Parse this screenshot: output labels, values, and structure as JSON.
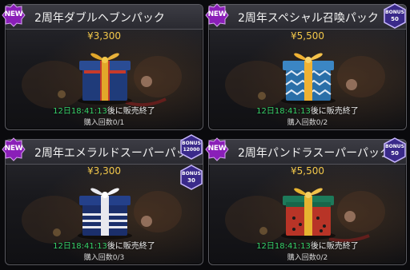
{
  "new_badge_label": "NEW",
  "bonus_label": "BONUS",
  "countdown_suffix": "後に販売終了",
  "cards": [
    {
      "title": "2周年ダブルヘブンパック",
      "price": "¥3,300",
      "countdown_time": "12日18:41:13",
      "purchases": "購入回数0/1",
      "box_color": "#1f3b7a",
      "ribbon_color": "#e2a72a"
    },
    {
      "title": "2周年スペシャル召喚パック",
      "price": "¥5,500",
      "countdown_time": "12日18:41:13",
      "purchases": "購入回数0/2",
      "bonus": "50",
      "bonus_icon": "crown-icon",
      "box_color": "#2a6fa8",
      "ribbon_color": "#f0b233"
    },
    {
      "title": "2周年エメラルドスーパーパック",
      "price": "¥3,300",
      "countdown_time": "12日18:41:13",
      "purchases": "購入回数0/3",
      "bonus": "12000",
      "bonus_icon": "emerald-icon",
      "bonus2": "30",
      "bonus2_icon": "crown-icon",
      "box_color": "#1b2f6b",
      "ribbon_color": "#e8e8ee"
    },
    {
      "title": "2周年パンドラスーパーパック",
      "price": "¥5,500",
      "countdown_time": "12日18:41:13",
      "purchases": "購入回数0/2",
      "bonus": "50",
      "bonus_icon": "crown-icon",
      "box_color": "#1d7a5a",
      "ribbon_color": "#e7b330"
    }
  ]
}
